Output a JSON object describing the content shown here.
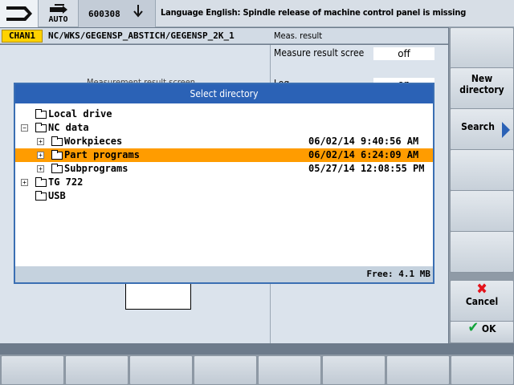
{
  "header": {
    "mode_label": "AUTO",
    "alarm_number": "600308",
    "alarm_message": "Language English: Spindle release of machine control panel is missing"
  },
  "pathbar": {
    "channel": "CHAN1",
    "path": "NC/WKS/GEGENSP_ABSTICH/GEGENSP_2K_1",
    "panel_title": "Meas. result"
  },
  "background": {
    "label": "Measurement result screen",
    "meas_rows": [
      {
        "label": "Measure result scree",
        "value": "off"
      },
      {
        "label": "Log",
        "value": "on"
      }
    ]
  },
  "dialog": {
    "title": "Select directory",
    "free_space": "Free: 4.1 MB",
    "items": [
      {
        "name": "Local drive",
        "date": "",
        "time": "",
        "level": 0,
        "expander": "",
        "selected": false
      },
      {
        "name": "NC data",
        "date": "",
        "time": "",
        "level": 0,
        "expander": "-",
        "selected": false
      },
      {
        "name": "Workpieces",
        "date": "06/02/14",
        "time": "9:40:56 AM",
        "level": 1,
        "expander": "+",
        "selected": false
      },
      {
        "name": "Part programs",
        "date": "06/02/14",
        "time": "6:24:09 AM",
        "level": 1,
        "expander": "+",
        "selected": true
      },
      {
        "name": "Subprograms",
        "date": "05/27/14",
        "time": "12:08:55 PM",
        "level": 1,
        "expander": "+",
        "selected": false
      },
      {
        "name": "TG 722",
        "date": "",
        "time": "",
        "level": 0,
        "expander": "+",
        "selected": false
      },
      {
        "name": "USB",
        "date": "",
        "time": "",
        "level": 0,
        "expander": "",
        "selected": false
      }
    ]
  },
  "softkeys": {
    "new_directory_line1": "New",
    "new_directory_line2": "directory",
    "search": "Search",
    "cancel": "Cancel",
    "ok": "OK"
  },
  "colors": {
    "selection": "#ff9c00",
    "title_bar": "#2b62b6",
    "channel": "#ffd200"
  }
}
